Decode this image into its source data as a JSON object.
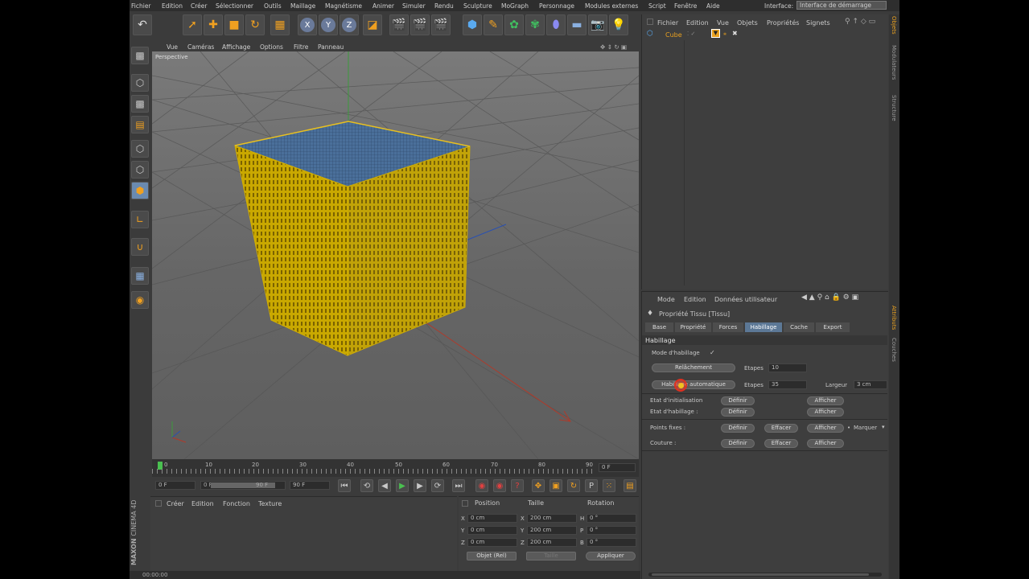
{
  "menu": [
    "Fichier",
    "Edition",
    "Créer",
    "Sélectionner",
    "Outils",
    "Maillage",
    "Magnétisme",
    "Animer",
    "Simuler",
    "Rendu",
    "Sculpture",
    "MoGraph",
    "Personnage",
    "Modules externes",
    "Script",
    "Fenêtre",
    "Aide"
  ],
  "interface": {
    "label": "Interface:",
    "value": "Interface de démarrage"
  },
  "toolbar_axes": [
    "X",
    "Y",
    "Z"
  ],
  "viewport": {
    "menu": [
      "Vue",
      "Caméras",
      "Affichage",
      "Options",
      "Filtre",
      "Panneau"
    ],
    "label": "Perspective"
  },
  "object_manager": {
    "menu": [
      "Fichier",
      "Edition",
      "Vue",
      "Objets",
      "Propriétés",
      "Signets"
    ],
    "object_name": "Cube"
  },
  "right_tabs": {
    "top": [
      "Objets",
      "Modulateurs",
      "Structure"
    ],
    "bottom": [
      "Attributs",
      "Couches"
    ]
  },
  "attributes": {
    "menu": [
      "Mode",
      "Edition",
      "Données utilisateur"
    ],
    "title": "Propriété Tissu [Tissu]",
    "tabs": [
      "Base",
      "Propriété",
      "Forces",
      "Habillage",
      "Cache",
      "Export"
    ],
    "active_tab": "Habillage",
    "section": "Habillage",
    "mode_label": "Mode d'habillage",
    "mode_check": "✓",
    "relax_button": "Relâchement",
    "etapes_label": "Etapes",
    "etapes1": "10",
    "auto_button": "Habillage automatique",
    "etapes2": "35",
    "largeur_label": "Largeur",
    "largeur_value": "3 cm",
    "state_init": "Etat d'initialisation",
    "state_hab": "Etat d'habillage :",
    "points_fixes": "Points fixes :",
    "couture": "Couture :",
    "define": "Définir",
    "show": "Afficher",
    "erase": "Effacer",
    "mark": "Marquer"
  },
  "timeline": {
    "ticks": [
      "0",
      "10",
      "20",
      "30",
      "40",
      "50",
      "60",
      "70",
      "80",
      "90"
    ],
    "current_frame": "0 F",
    "start": "0 F",
    "min": "0 F",
    "max_inner": "90 F",
    "end": "90 F"
  },
  "material_manager": {
    "menu": [
      "Créer",
      "Edition",
      "Fonction",
      "Texture"
    ]
  },
  "coordinates": {
    "headers": [
      "Position",
      "Taille",
      "Rotation"
    ],
    "rows": [
      {
        "axis": "X",
        "pos": "0 cm",
        "size_axis": "X",
        "size": "200 cm",
        "rot_axis": "H",
        "rot": "0 °"
      },
      {
        "axis": "Y",
        "pos": "0 cm",
        "size_axis": "Y",
        "size": "200 cm",
        "rot_axis": "P",
        "rot": "0 °"
      },
      {
        "axis": "Z",
        "pos": "0 cm",
        "size_axis": "Z",
        "size": "200 cm",
        "rot_axis": "B",
        "rot": "0 °"
      }
    ],
    "mode": "Objet (Rel)",
    "size_mode": "Taille",
    "apply": "Appliquer"
  },
  "status": "00:00:00",
  "brand": {
    "maxon": "MAXON",
    "c4d": "CINEMA 4D"
  },
  "colors": {
    "accent": "#e8a020",
    "cube_side": "#c9a800",
    "cube_top": "#4a6f9a",
    "active_tab": "#5c7896"
  }
}
